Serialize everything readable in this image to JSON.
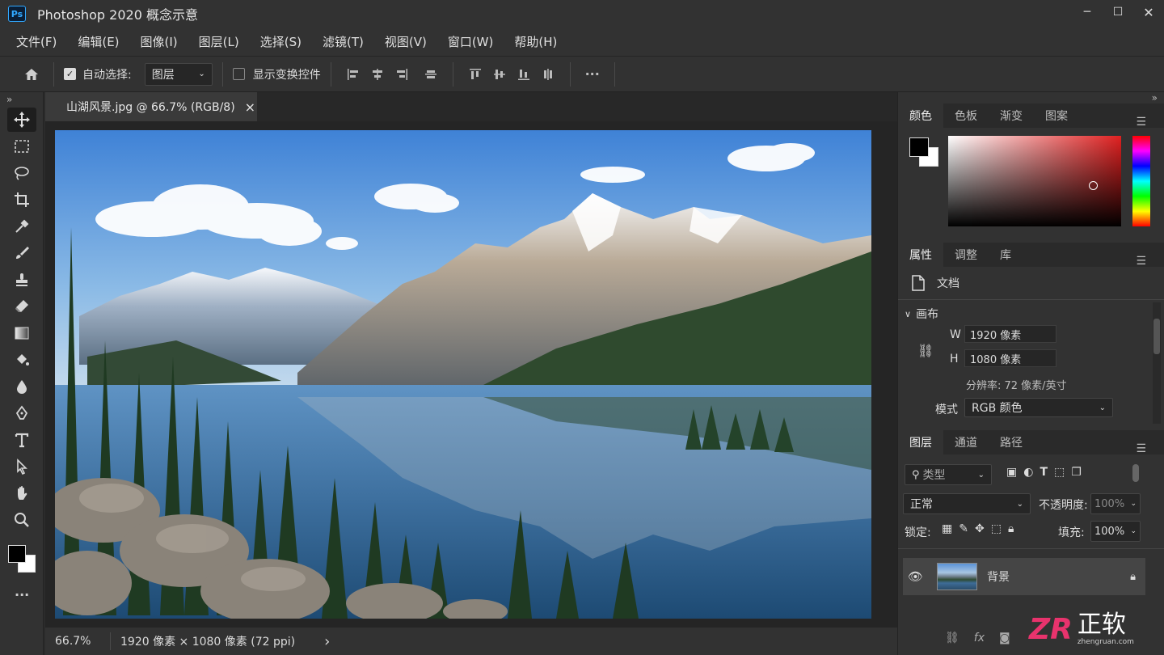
{
  "app": {
    "logo": "Ps",
    "title": "Photoshop 2020  概念示意"
  },
  "window_controls": {
    "minimize": "─",
    "maximize": "☐",
    "close": "✕"
  },
  "menu": [
    "文件(F)",
    "编辑(E)",
    "图像(I)",
    "图层(L)",
    "选择(S)",
    "滤镜(T)",
    "视图(V)",
    "窗口(W)",
    "帮助(H)"
  ],
  "options": {
    "auto_select_label": "自动选择:",
    "auto_select_checked": true,
    "target_value": "图层",
    "show_transform_label": "显示变换控件",
    "show_transform_checked": false,
    "more": "···"
  },
  "panel_collapse": "»",
  "document": {
    "tab_label": "山湖风景.jpg @ 66.7% (RGB/8)",
    "close": "×"
  },
  "status": {
    "zoom": "66.7%",
    "info": "1920 像素 × 1080 像素 (72 ppi)",
    "arrow": "›"
  },
  "color_panel": {
    "tabs": [
      "颜色",
      "色板",
      "渐变",
      "图案"
    ],
    "active": 0,
    "foreground": "#000000",
    "background": "#ffffff",
    "hue": "#e02020"
  },
  "properties_panel": {
    "tabs": [
      "属性",
      "调整",
      "库"
    ],
    "active": 0,
    "doc_label": "文档",
    "canvas_header": "画布",
    "w_label": "W",
    "w_value": "1920 像素",
    "h_label": "H",
    "h_value": "1080 像素",
    "resolution": "分辨率: 72 像素/英寸",
    "mode_label": "模式",
    "mode_value": "RGB 颜色"
  },
  "layers_panel": {
    "tabs": [
      "图层",
      "通道",
      "路径"
    ],
    "active": 0,
    "filter_label": "类型",
    "blend_mode": "正常",
    "opacity_label": "不透明度:",
    "opacity_value": "100%",
    "lock_label": "锁定:",
    "fill_label": "填充:",
    "fill_value": "100%",
    "layers": [
      {
        "name": "背景",
        "visible": true,
        "locked": true
      }
    ],
    "footer_fx": "fx"
  },
  "watermark": {
    "mark": "ZR",
    "text": "正软",
    "url": "zhengruan.com"
  }
}
